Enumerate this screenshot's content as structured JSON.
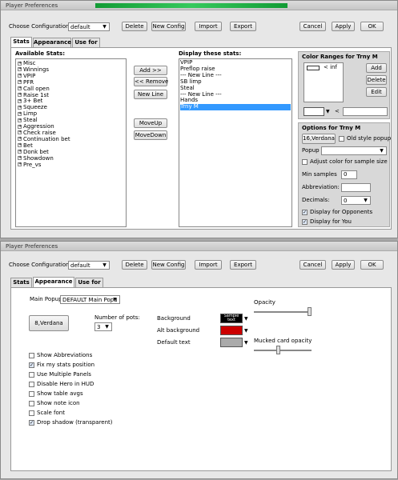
{
  "window_title": "Player Preferences",
  "choose_config_label": "Choose Configuration:",
  "config_value": "default",
  "buttons": {
    "delete": "Delete",
    "new_config": "New Config",
    "import": "Import",
    "export": "Export",
    "cancel": "Cancel",
    "apply": "Apply",
    "ok": "OK"
  },
  "tabs": [
    "Stats",
    "Appearance",
    "Use for"
  ],
  "stats": {
    "available_label": "Available Stats:",
    "available": [
      "Misc",
      "Winnings",
      "VPIP",
      "PFR",
      "Call open",
      "Raise 1st",
      "3+ Bet",
      "Squeeze",
      "Limp",
      "Steal",
      "Aggression",
      "Check raise",
      "Continuation bet",
      "Bet",
      "Donk bet",
      "Showdown",
      "Pre_vs"
    ],
    "add_btn": "Add >>",
    "remove_btn": "<< Remove",
    "newline_btn": "New Line",
    "moveup_btn": "MoveUp",
    "movedown_btn": "MoveDown",
    "display_label": "Display these stats:",
    "display": [
      "VPIP",
      "Preflop raise",
      "--- New Line ---",
      "SB limp",
      "Steal",
      "--- New Line ---",
      "Hands",
      "Trny M"
    ],
    "selected_display": "Trny M",
    "color_ranges_title": "Color Ranges for Trny M",
    "range_text": "< inf",
    "range_add": "Add",
    "range_delete": "Delete",
    "range_edit": "Edit",
    "range_lt": "<",
    "options_title": "Options for Trny M",
    "font_btn": "16,Verdana",
    "old_style_popup": "Old style popup",
    "popup_label": "Popup",
    "adjust_color": "Adjust color for sample size",
    "min_samples_label": "Min samples",
    "min_samples": "0",
    "abbreviation_label": "Abbreviation:",
    "decimals_label": "Decimals:",
    "decimals": "0",
    "display_opponents": "Display for Opponents",
    "display_you": "Display for You"
  },
  "appearance": {
    "main_popup_label": "Main Popup",
    "main_popup_value": "DEFAULT Main Popu",
    "font_btn": "8,Verdana",
    "num_pots_label": "Number of pots:",
    "num_pots": "3",
    "background_label": "Background",
    "background_swatch_text": "Sample text",
    "alt_background_label": "Alt background",
    "default_text_label": "Default text",
    "opacity_label": "Opacity",
    "opacity_value": 1.0,
    "mucked_label": "Mucked card opacity",
    "mucked_value": 0.42,
    "colors": {
      "background": "#000000",
      "alt_background": "#cc0000",
      "default_text": "#aaaaaa"
    },
    "checkboxes": [
      {
        "label": "Show Abbreviations",
        "checked": false
      },
      {
        "label": "Fix my stats position",
        "checked": true
      },
      {
        "label": "Use Multiple Panels",
        "checked": false
      },
      {
        "label": "Disable Hero in HUD",
        "checked": false
      },
      {
        "label": "Show table avgs",
        "checked": false
      },
      {
        "label": "Show note icon",
        "checked": false
      },
      {
        "label": "Scale font",
        "checked": false
      },
      {
        "label": "Drop shadow (transparent)",
        "checked": true
      }
    ]
  }
}
